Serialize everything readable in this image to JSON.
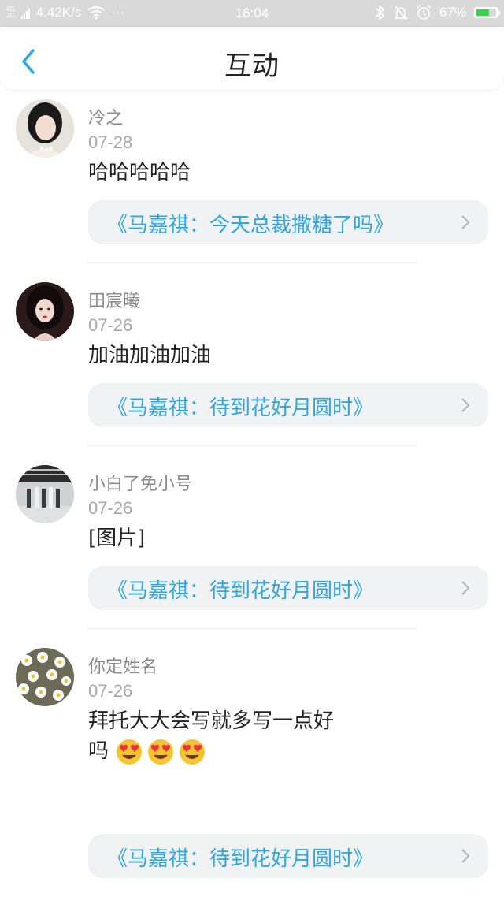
{
  "status_bar": {
    "network_type_top": "4G",
    "network_type_bottom": "2G",
    "speed": "4.42K/s",
    "more": "···",
    "time": "16:04",
    "battery_percent": "67%",
    "battery_level": 0.67,
    "icons": [
      "bluetooth-icon",
      "mute-icon",
      "alarm-icon",
      "wifi-icon"
    ]
  },
  "header": {
    "title": "互动",
    "back_icon": "chevron-left-icon",
    "accent_color": "#2ea6df"
  },
  "interactions": [
    {
      "username": "冷之",
      "date": "07-28",
      "comment": "哈哈哈哈哈",
      "link": "《马嘉祺：今天总裁撒糖了吗》"
    },
    {
      "username": "田宸曦",
      "date": "07-26",
      "comment": "加油加油加油",
      "link": "《马嘉祺：待到花好月圆时》"
    },
    {
      "username": "小白了免小号",
      "date": "07-26",
      "comment": "[图片]",
      "link": "《马嘉祺：待到花好月圆时》"
    },
    {
      "username": "你定姓名",
      "date": "07-26",
      "comment_line1": "拜托大大会写就多写一点好",
      "comment_line2": "吗",
      "emoji": [
        "heart-eyes-emoji",
        "heart-eyes-emoji",
        "heart-eyes-emoji"
      ],
      "link": "《马嘉祺：待到花好月圆时》"
    }
  ]
}
